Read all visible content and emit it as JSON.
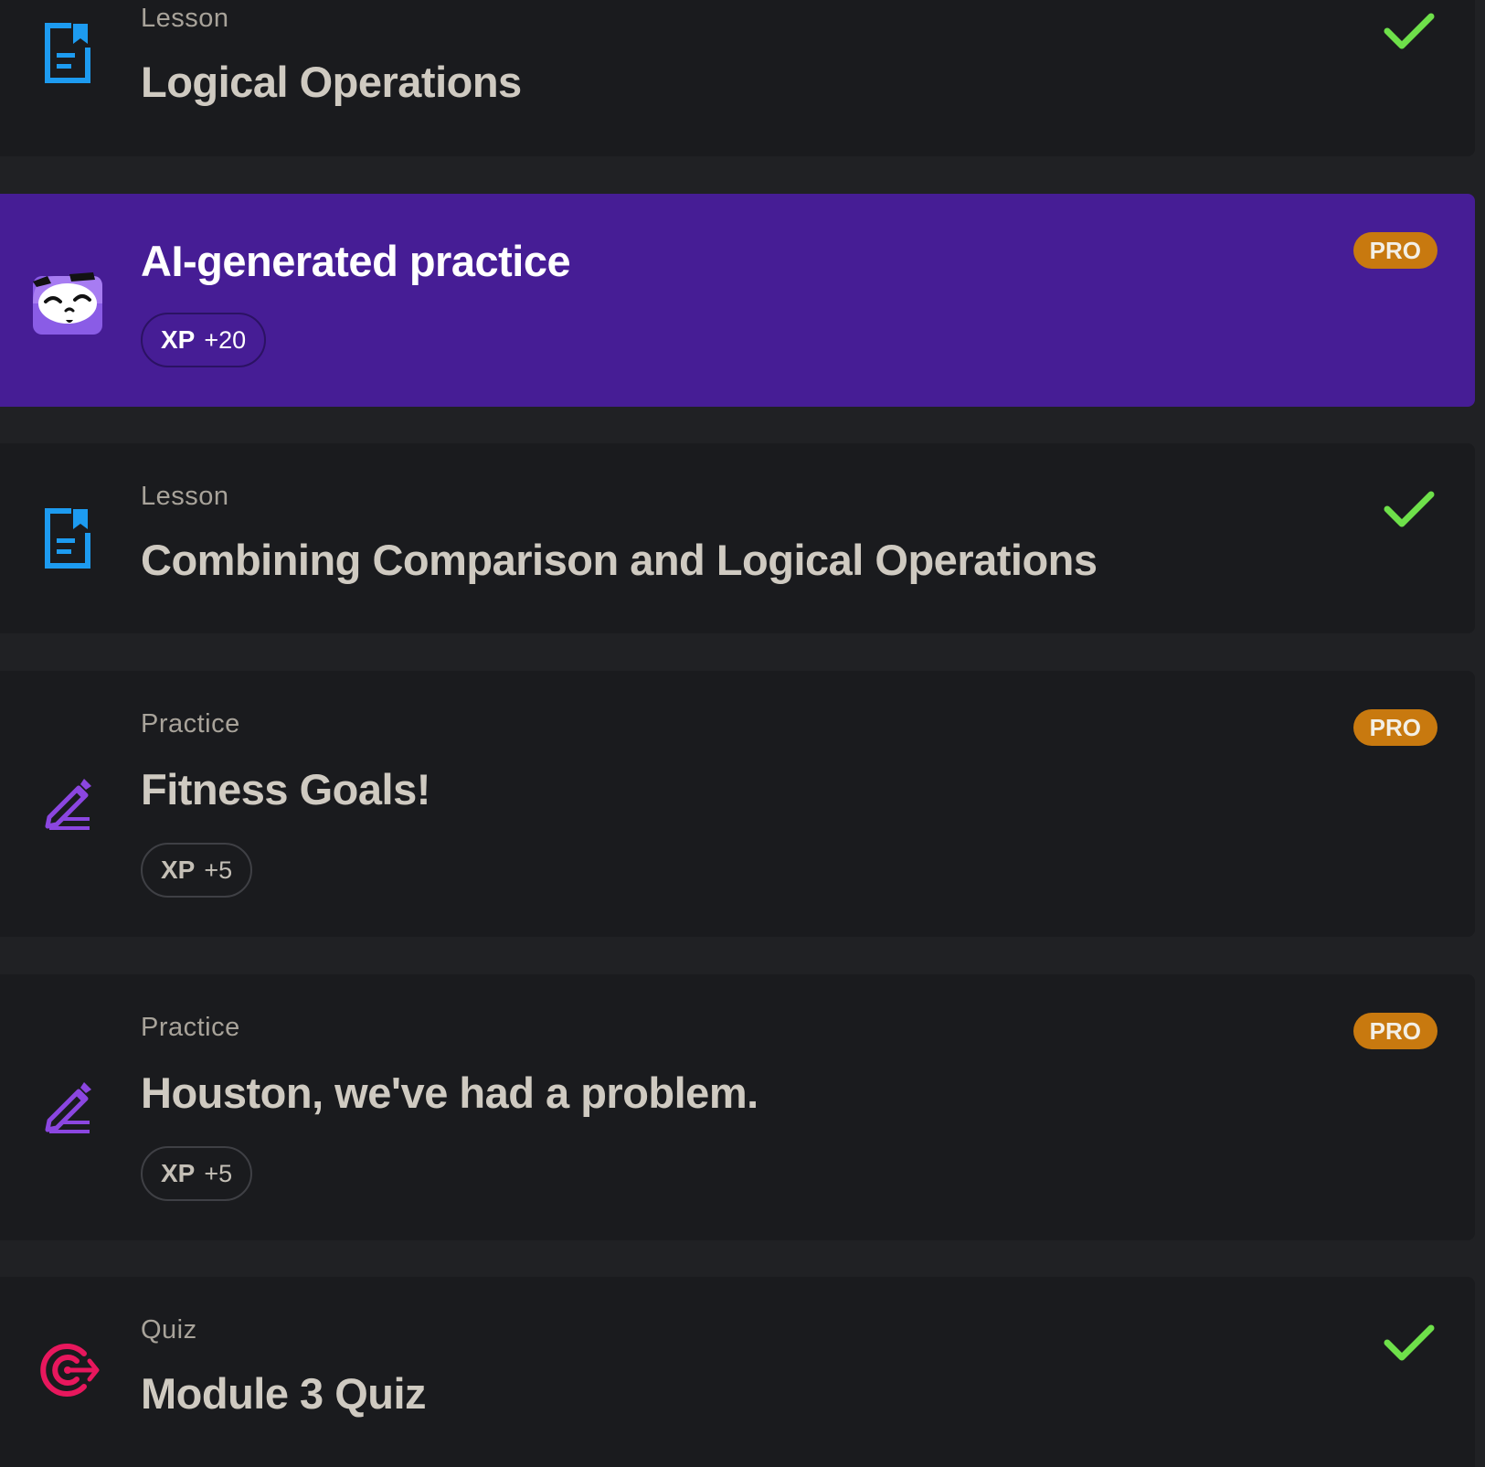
{
  "items": [
    {
      "kind": "Lesson",
      "title": "Logical Operations",
      "icon": "lesson-document-icon",
      "completed": true
    },
    {
      "title": "AI-generated practice",
      "icon": "ai-mascot-icon",
      "badge": "PRO",
      "xp_label": "XP",
      "xp_value": "+20"
    },
    {
      "kind": "Lesson",
      "title": "Combining Comparison and Logical Operations",
      "icon": "lesson-document-icon",
      "completed": true
    },
    {
      "kind": "Practice",
      "title": "Fitness Goals!",
      "icon": "pencil-icon",
      "badge": "PRO",
      "xp_label": "XP",
      "xp_value": "+5"
    },
    {
      "kind": "Practice",
      "title": "Houston, we've had a problem.",
      "icon": "pencil-icon",
      "badge": "PRO",
      "xp_label": "XP",
      "xp_value": "+5"
    },
    {
      "kind": "Quiz",
      "title": "Module 3 Quiz",
      "icon": "target-icon",
      "completed": true
    }
  ],
  "colors": {
    "page_background": "#202124",
    "card_background": "#1a1b1e",
    "ai_card_background": "#461d95",
    "lesson_icon": "#1d9bf0",
    "practice_icon": "#8b46e0",
    "quiz_icon": "#e8175d",
    "check": "#6ee04a",
    "pro_badge": "#c8790f"
  }
}
